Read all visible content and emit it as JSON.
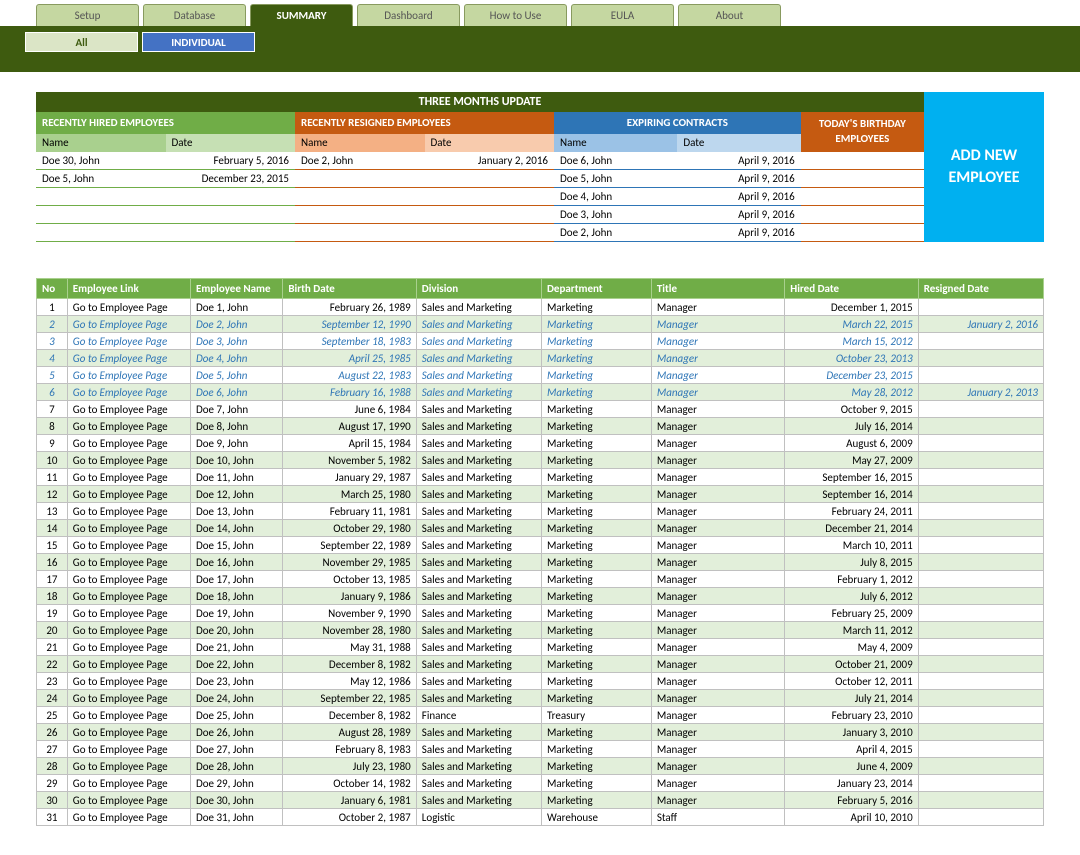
{
  "tabs": [
    "Setup",
    "Database",
    "SUMMARY",
    "Dashboard",
    "How to Use",
    "EULA",
    "About"
  ],
  "active_tab": 2,
  "subtabs": [
    "All",
    "INDIVIDUAL"
  ],
  "active_subtab": 1,
  "update_title": "THREE MONTHS UPDATE",
  "sections": {
    "hired": {
      "title": "RECENTLY HIRED EMPLOYEES",
      "cols": [
        "Name",
        "Date"
      ],
      "rows": [
        {
          "name": "Doe 30, John",
          "date": "February 5, 2016"
        },
        {
          "name": "Doe 5, John",
          "date": "December 23, 2015"
        },
        {
          "name": "",
          "date": ""
        },
        {
          "name": "",
          "date": ""
        },
        {
          "name": "",
          "date": ""
        }
      ]
    },
    "resigned": {
      "title": "RECENTLY RESIGNED EMPLOYEES",
      "cols": [
        "Name",
        "Date"
      ],
      "rows": [
        {
          "name": "Doe 2, John",
          "date": "January 2, 2016"
        },
        {
          "name": "",
          "date": ""
        },
        {
          "name": "",
          "date": ""
        },
        {
          "name": "",
          "date": ""
        },
        {
          "name": "",
          "date": ""
        }
      ]
    },
    "expiring": {
      "title": "EXPIRING CONTRACTS",
      "cols": [
        "Name",
        "Date"
      ],
      "rows": [
        {
          "name": "Doe 6, John",
          "date": "April 9, 2016"
        },
        {
          "name": "Doe 5, John",
          "date": "April 9, 2016"
        },
        {
          "name": "Doe 4, John",
          "date": "April 9, 2016"
        },
        {
          "name": "Doe 3, John",
          "date": "April 9, 2016"
        },
        {
          "name": "Doe 2, John",
          "date": "April 9, 2016"
        }
      ]
    },
    "birthday": {
      "title": "TODAY'S BIRTHDAY EMPLOYEES",
      "rows": [
        "",
        "",
        "",
        "",
        ""
      ]
    }
  },
  "add_new_label": "ADD NEW EMPLOYEE",
  "table": {
    "headers": [
      "No",
      "Employee Link",
      "Employee Name",
      "Birth Date",
      "Division",
      "Department",
      "Title",
      "Hired Date",
      "Resigned Date"
    ],
    "rows": [
      {
        "no": 1,
        "link": "Go to Employee Page",
        "name": "Doe 1, John",
        "birth": "February 26, 1989",
        "div": "Sales and Marketing",
        "dep": "Marketing",
        "title": "Manager",
        "hired": "December 1, 2015",
        "res": "",
        "teal": false
      },
      {
        "no": 2,
        "link": "Go to Employee Page",
        "name": "Doe 2, John",
        "birth": "September 12, 1990",
        "div": "Sales and Marketing",
        "dep": "Marketing",
        "title": "Manager",
        "hired": "March 22, 2015",
        "res": "January 2, 2016",
        "teal": true
      },
      {
        "no": 3,
        "link": "Go to Employee Page",
        "name": "Doe 3, John",
        "birth": "September 18, 1983",
        "div": "Sales and Marketing",
        "dep": "Marketing",
        "title": "Manager",
        "hired": "March 15, 2012",
        "res": "",
        "teal": true
      },
      {
        "no": 4,
        "link": "Go to Employee Page",
        "name": "Doe 4, John",
        "birth": "April 25, 1985",
        "div": "Sales and Marketing",
        "dep": "Marketing",
        "title": "Manager",
        "hired": "October 23, 2013",
        "res": "",
        "teal": true
      },
      {
        "no": 5,
        "link": "Go to Employee Page",
        "name": "Doe 5, John",
        "birth": "August 22, 1983",
        "div": "Sales and Marketing",
        "dep": "Marketing",
        "title": "Manager",
        "hired": "December 23, 2015",
        "res": "",
        "teal": true
      },
      {
        "no": 6,
        "link": "Go to Employee Page",
        "name": "Doe 6, John",
        "birth": "February 16, 1988",
        "div": "Sales and Marketing",
        "dep": "Marketing",
        "title": "Manager",
        "hired": "May 28, 2012",
        "res": "January 2, 2013",
        "teal": true
      },
      {
        "no": 7,
        "link": "Go to Employee Page",
        "name": "Doe 7, John",
        "birth": "June 6, 1984",
        "div": "Sales and Marketing",
        "dep": "Marketing",
        "title": "Manager",
        "hired": "October 9, 2015",
        "res": "",
        "teal": false
      },
      {
        "no": 8,
        "link": "Go to Employee Page",
        "name": "Doe 8, John",
        "birth": "August 17, 1990",
        "div": "Sales and Marketing",
        "dep": "Marketing",
        "title": "Manager",
        "hired": "July 16, 2014",
        "res": "",
        "teal": false
      },
      {
        "no": 9,
        "link": "Go to Employee Page",
        "name": "Doe 9, John",
        "birth": "April 15, 1984",
        "div": "Sales and Marketing",
        "dep": "Marketing",
        "title": "Manager",
        "hired": "August 6, 2009",
        "res": "",
        "teal": false
      },
      {
        "no": 10,
        "link": "Go to Employee Page",
        "name": "Doe 10, John",
        "birth": "November 5, 1982",
        "div": "Sales and Marketing",
        "dep": "Marketing",
        "title": "Manager",
        "hired": "May 27, 2009",
        "res": "",
        "teal": false
      },
      {
        "no": 11,
        "link": "Go to Employee Page",
        "name": "Doe 11, John",
        "birth": "January 29, 1987",
        "div": "Sales and Marketing",
        "dep": "Marketing",
        "title": "Manager",
        "hired": "September 16, 2015",
        "res": "",
        "teal": false
      },
      {
        "no": 12,
        "link": "Go to Employee Page",
        "name": "Doe 12, John",
        "birth": "March 25, 1980",
        "div": "Sales and Marketing",
        "dep": "Marketing",
        "title": "Manager",
        "hired": "September 16, 2014",
        "res": "",
        "teal": false
      },
      {
        "no": 13,
        "link": "Go to Employee Page",
        "name": "Doe 13, John",
        "birth": "February 11, 1981",
        "div": "Sales and Marketing",
        "dep": "Marketing",
        "title": "Manager",
        "hired": "February 24, 2011",
        "res": "",
        "teal": false
      },
      {
        "no": 14,
        "link": "Go to Employee Page",
        "name": "Doe 14, John",
        "birth": "October 29, 1980",
        "div": "Sales and Marketing",
        "dep": "Marketing",
        "title": "Manager",
        "hired": "December 21, 2014",
        "res": "",
        "teal": false
      },
      {
        "no": 15,
        "link": "Go to Employee Page",
        "name": "Doe 15, John",
        "birth": "September 22, 1989",
        "div": "Sales and Marketing",
        "dep": "Marketing",
        "title": "Manager",
        "hired": "March 10, 2011",
        "res": "",
        "teal": false
      },
      {
        "no": 16,
        "link": "Go to Employee Page",
        "name": "Doe 16, John",
        "birth": "November 29, 1985",
        "div": "Sales and Marketing",
        "dep": "Marketing",
        "title": "Manager",
        "hired": "July 8, 2015",
        "res": "",
        "teal": false
      },
      {
        "no": 17,
        "link": "Go to Employee Page",
        "name": "Doe 17, John",
        "birth": "October 13, 1985",
        "div": "Sales and Marketing",
        "dep": "Marketing",
        "title": "Manager",
        "hired": "February 1, 2012",
        "res": "",
        "teal": false
      },
      {
        "no": 18,
        "link": "Go to Employee Page",
        "name": "Doe 18, John",
        "birth": "January 9, 1986",
        "div": "Sales and Marketing",
        "dep": "Marketing",
        "title": "Manager",
        "hired": "July 6, 2012",
        "res": "",
        "teal": false
      },
      {
        "no": 19,
        "link": "Go to Employee Page",
        "name": "Doe 19, John",
        "birth": "November 9, 1990",
        "div": "Sales and Marketing",
        "dep": "Marketing",
        "title": "Manager",
        "hired": "February 25, 2009",
        "res": "",
        "teal": false
      },
      {
        "no": 20,
        "link": "Go to Employee Page",
        "name": "Doe 20, John",
        "birth": "November 28, 1980",
        "div": "Sales and Marketing",
        "dep": "Marketing",
        "title": "Manager",
        "hired": "March 11, 2012",
        "res": "",
        "teal": false
      },
      {
        "no": 21,
        "link": "Go to Employee Page",
        "name": "Doe 21, John",
        "birth": "May 31, 1988",
        "div": "Sales and Marketing",
        "dep": "Marketing",
        "title": "Manager",
        "hired": "May 4, 2009",
        "res": "",
        "teal": false
      },
      {
        "no": 22,
        "link": "Go to Employee Page",
        "name": "Doe 22, John",
        "birth": "December 8, 1982",
        "div": "Sales and Marketing",
        "dep": "Marketing",
        "title": "Manager",
        "hired": "October 21, 2009",
        "res": "",
        "teal": false
      },
      {
        "no": 23,
        "link": "Go to Employee Page",
        "name": "Doe 23, John",
        "birth": "May 12, 1986",
        "div": "Sales and Marketing",
        "dep": "Marketing",
        "title": "Manager",
        "hired": "October 12, 2011",
        "res": "",
        "teal": false
      },
      {
        "no": 24,
        "link": "Go to Employee Page",
        "name": "Doe 24, John",
        "birth": "September 22, 1985",
        "div": "Sales and Marketing",
        "dep": "Marketing",
        "title": "Manager",
        "hired": "July 21, 2014",
        "res": "",
        "teal": false
      },
      {
        "no": 25,
        "link": "Go to Employee Page",
        "name": "Doe 25, John",
        "birth": "December 8, 1982",
        "div": "Finance",
        "dep": "Treasury",
        "title": "Manager",
        "hired": "February 23, 2010",
        "res": "",
        "teal": false
      },
      {
        "no": 26,
        "link": "Go to Employee Page",
        "name": "Doe 26, John",
        "birth": "August 28, 1989",
        "div": "Sales and Marketing",
        "dep": "Marketing",
        "title": "Manager",
        "hired": "January 3, 2010",
        "res": "",
        "teal": false
      },
      {
        "no": 27,
        "link": "Go to Employee Page",
        "name": "Doe 27, John",
        "birth": "February 8, 1983",
        "div": "Sales and Marketing",
        "dep": "Marketing",
        "title": "Manager",
        "hired": "April 4, 2015",
        "res": "",
        "teal": false
      },
      {
        "no": 28,
        "link": "Go to Employee Page",
        "name": "Doe 28, John",
        "birth": "July 23, 1980",
        "div": "Sales and Marketing",
        "dep": "Marketing",
        "title": "Manager",
        "hired": "June 4, 2009",
        "res": "",
        "teal": false
      },
      {
        "no": 29,
        "link": "Go to Employee Page",
        "name": "Doe 29, John",
        "birth": "October 14, 1982",
        "div": "Sales and Marketing",
        "dep": "Marketing",
        "title": "Manager",
        "hired": "January 23, 2014",
        "res": "",
        "teal": false
      },
      {
        "no": 30,
        "link": "Go to Employee Page",
        "name": "Doe 30, John",
        "birth": "January 6, 1981",
        "div": "Sales and Marketing",
        "dep": "Marketing",
        "title": "Manager",
        "hired": "February 5, 2016",
        "res": "",
        "teal": false
      },
      {
        "no": 31,
        "link": "Go to Employee Page",
        "name": "Doe 31, John",
        "birth": "October 2, 1987",
        "div": "Logistic",
        "dep": "Warehouse",
        "title": "Staff",
        "hired": "April 10, 2010",
        "res": "",
        "teal": false
      }
    ]
  }
}
